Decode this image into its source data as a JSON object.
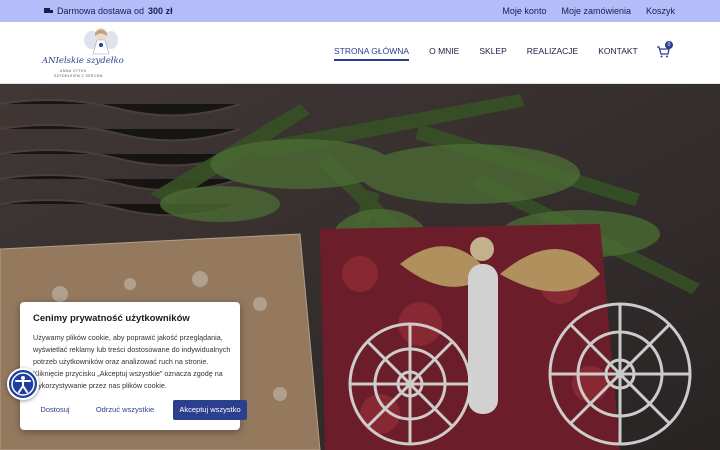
{
  "topbar": {
    "shipping_text": "Darmowa dostawa od",
    "shipping_amount": "300 zł",
    "links": [
      "Moje konto",
      "Moje zamówienia",
      "Koszyk"
    ]
  },
  "logo": {
    "name": "ANIelskie szydełko",
    "tagline": "ANNA ZYTEK",
    "subtagline": "SZYDEŁKIEM Z SERCEM"
  },
  "nav": {
    "items": [
      "STRONA GŁÓWNA",
      "O MNIE",
      "SKLEP",
      "REALIZACJE",
      "KONTAKT"
    ],
    "active": "STRONA GŁÓWNA"
  },
  "cart": {
    "count": "0"
  },
  "cookie": {
    "title": "Cenimy prywatność użytkowników",
    "body": "Używamy plików cookie, aby poprawić jakość przeglądania, wyświetlać reklamy lub treści dostosowane do indywidualnych potrzeb użytkowników oraz analizować ruch na stronie. Kliknięcie przycisku „Akceptuj wszystkie” oznacza zgodę na wykorzystywanie przez nas plików cookie.",
    "customize_label": "Dostosuj",
    "reject_label": "Odrzuć wszystkie",
    "accept_label": "Akceptuj wszystko"
  },
  "colors": {
    "topbar_bg": "#b3bdfa",
    "brand": "#2b3f8f",
    "accent_button": "#2b3f8f"
  },
  "icons": {
    "truck": "truck-icon",
    "cart": "cart-icon",
    "accessibility": "accessibility-icon"
  }
}
